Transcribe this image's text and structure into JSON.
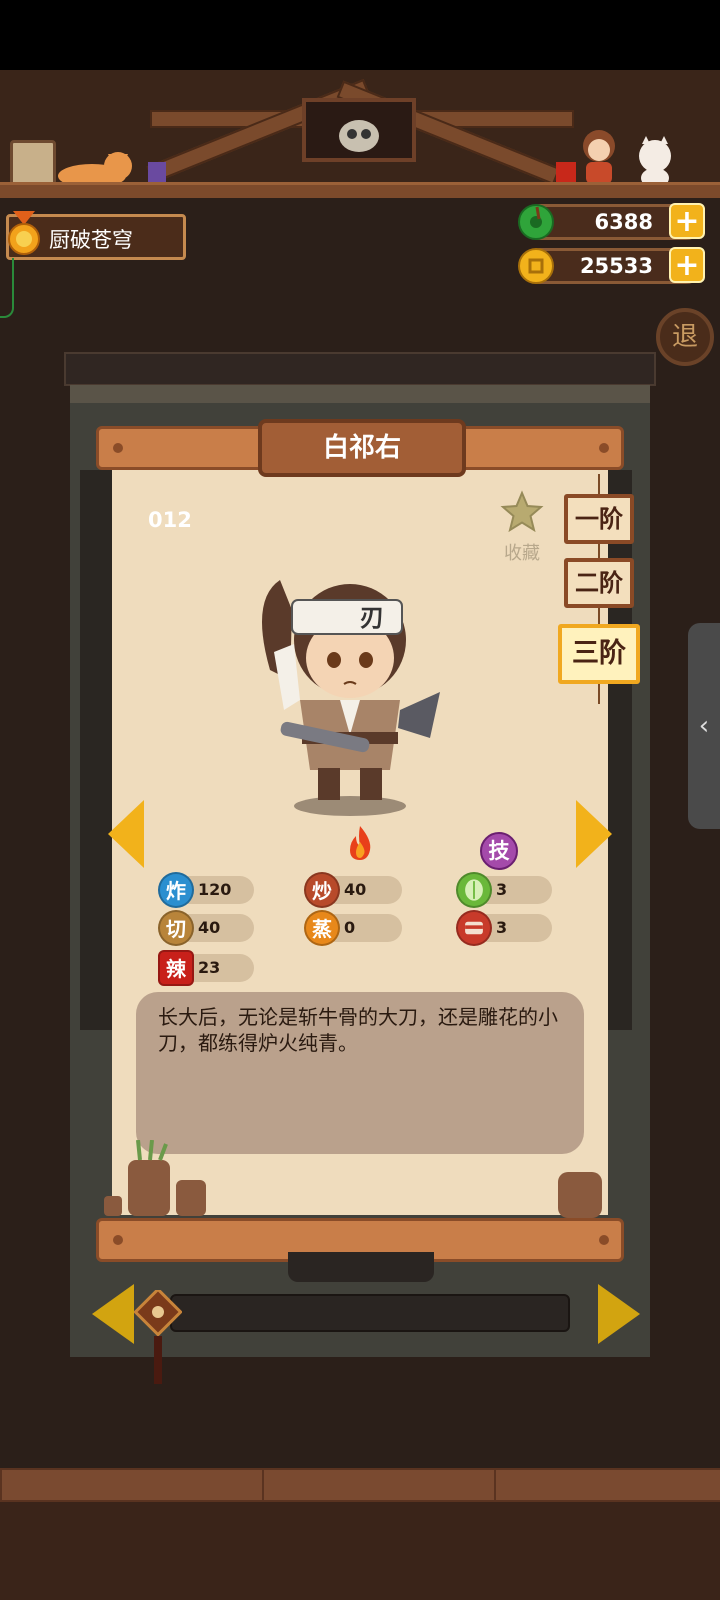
{
  "player": {
    "title": "厨破苍穹"
  },
  "currency": {
    "gems": {
      "value": "6388",
      "icon": "jade-icon",
      "color": "#2fa43a"
    },
    "coins": {
      "value": "25533",
      "icon": "coin-icon",
      "color": "#e8a820"
    }
  },
  "buttons": {
    "exit": "退",
    "plus": "+"
  },
  "character": {
    "name": "白祁右",
    "id": "012",
    "favorite_label": "收藏",
    "tiers": [
      "一阶",
      "二阶",
      "三阶"
    ],
    "active_tier": 2,
    "description": "长大后，无论是斩牛骨的大刀，还是雕花的小刀，都练得炉火纯青。"
  },
  "stats": [
    {
      "icon_text": "炸",
      "value": "120",
      "color": "#2b8fd0"
    },
    {
      "icon_text": "炒",
      "value": "40",
      "color": "#b84a2a"
    },
    {
      "icon_text": "切",
      "value": "40",
      "color": "#b8843a"
    },
    {
      "icon_text": "蒸",
      "value": "0",
      "color": "#e8881a"
    },
    {
      "icon_text": "辣",
      "value": "23",
      "color": "#c8201a"
    }
  ],
  "skills": {
    "badge": "技",
    "items": [
      {
        "icon": "cabbage-icon",
        "value": "3"
      },
      {
        "icon": "meat-icon",
        "value": "3"
      }
    ]
  }
}
